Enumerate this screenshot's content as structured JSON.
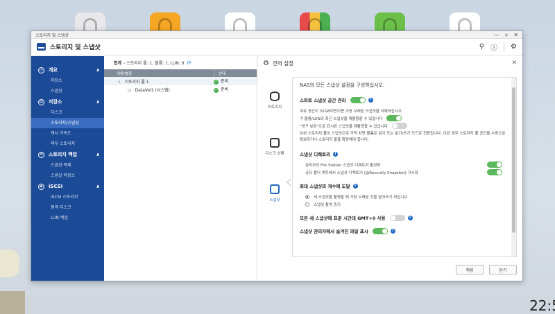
{
  "window": {
    "title": "스토리지 및 스냅샷",
    "controls": [
      "—",
      "+",
      "✕"
    ]
  },
  "app": {
    "title": "스토리지 및 스냅샷"
  },
  "sidebar": {
    "sections": [
      {
        "label": "개요",
        "items": [
          "저장소",
          "스냅샷"
        ]
      },
      {
        "label": "저장소",
        "items": [
          "디스크",
          "스토리지/스냅샷",
          "캐시 가속도",
          "외부 스토리지"
        ]
      },
      {
        "label": "스토리지 백업",
        "items": [
          "스냅샷 복제",
          "스냅샷 저장소"
        ]
      },
      {
        "label": "iSCSI",
        "items": [
          "iSCSI 스토리지",
          "원격 디스크",
          "LUN 백업"
        ]
      }
    ]
  },
  "list": {
    "summary_label": "합계",
    "summary_text": "- 스토리지 풀: 1, 볼륨: 1, LUN: 0",
    "columns": [
      "이름/별칭",
      "상태"
    ],
    "rows": [
      {
        "name": "스토리지 풀 1",
        "status": "준비"
      },
      {
        "name": "DataVol1 (시스템)",
        "status": "준비"
      }
    ]
  },
  "settings": {
    "title": "전역 설정",
    "tabs": [
      "스토리지",
      "디스크 상태",
      "스냅샷"
    ],
    "intro": "NAS의 모든 스냅샷 설정을 구성하십시오.",
    "smart_space": {
      "heading": "스마트 스냅샷 공간 관리",
      "desc": "여유 공간이 32GB미만이면 가장 오래된 스냅샷을 삭제하십시오.",
      "opt1": "각 볼륨/LUN의 최근 스냅샷을 재활용할 수 있습니다",
      "opt2": "\"영구 보존\"으로 표시된 스냅샷을 재활용할 수 있습니다",
      "note": "상위 스토리지 풀이 스냅샷으로 가득 차면 볼륨은 읽기 또는 읽기/쓰기 모드로 전환됩니다. 이런 경우 스토리지 풀 공간을 수동으로 확보하거나 스토리지 풀을 확장해야 합니다."
    },
    "snapshot_dir": {
      "heading": "스냅샷 디렉토리",
      "opt1": "관리자의 File Station 스냅샷 디렉토리 활성화",
      "opt2": "공유 폴더 루트에서 스냅샷 디렉토리 (@Recently-Snapshot) 가시화"
    },
    "max_snapshots": {
      "heading": "최대 스냅샷의 개수에 도달",
      "opt1": "새 스냅샷을 촬영할 때 가장 오래된 것을 덮어쓰기 하십시오",
      "opt2": "스냅샷 촬영 중지"
    },
    "gmt": {
      "label": "모든 새 스냅샷에 표준 시간대 GMT+0 사용"
    },
    "hidden": {
      "label": "스냅샷 관리자에서 숨겨진 파일 표시"
    },
    "buttons": {
      "apply": "적용",
      "close": "닫기"
    }
  },
  "clock": "22:5"
}
